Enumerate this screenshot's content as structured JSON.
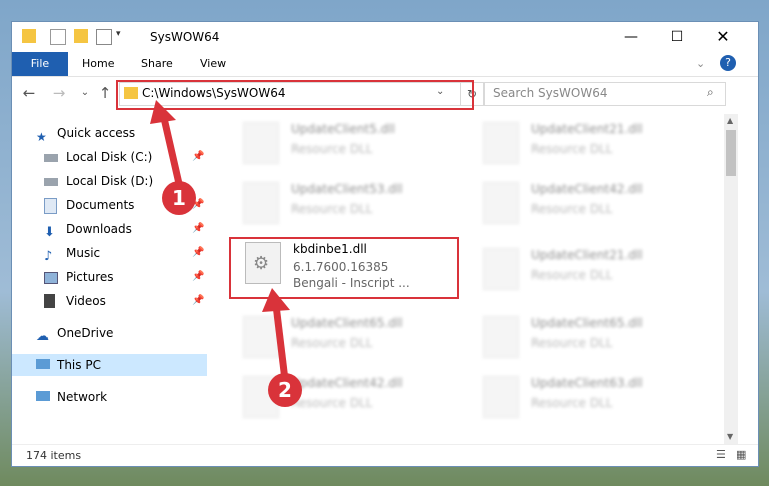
{
  "window": {
    "title": "SysWOW64"
  },
  "ribbon": {
    "tabs": [
      "File",
      "Home",
      "Share",
      "View"
    ]
  },
  "address": {
    "path": "C:\\Windows\\SysWOW64",
    "search_placeholder": "Search SysWOW64"
  },
  "sidebar": {
    "items": [
      {
        "label": "Quick access",
        "pinned": false
      },
      {
        "label": "Local Disk (C:)",
        "pinned": true
      },
      {
        "label": "Local Disk (D:)",
        "pinned": false
      },
      {
        "label": "Documents",
        "pinned": true
      },
      {
        "label": "Downloads",
        "pinned": true
      },
      {
        "label": "Music",
        "pinned": true
      },
      {
        "label": "Pictures",
        "pinned": true
      },
      {
        "label": "Videos",
        "pinned": true
      },
      {
        "label": "OneDrive",
        "pinned": false
      },
      {
        "label": "This PC",
        "pinned": false,
        "selected": true
      },
      {
        "label": "Network",
        "pinned": false
      }
    ]
  },
  "files": {
    "left": [
      {
        "name": "UpdateClient5.dll",
        "sub": "Resource DLL"
      },
      {
        "name": "UpdateClient53.dll",
        "sub": "Resource DLL"
      },
      {
        "name": "kbdinbe1.dll",
        "sub": "6.1.7600.16385",
        "sub2": "Bengali - Inscript ..."
      },
      {
        "name": "UpdateClient65.dll",
        "sub": "Resource DLL"
      },
      {
        "name": "UpdateClient42.dll",
        "sub": "Resource DLL"
      }
    ],
    "right": [
      {
        "name": "UpdateClient21.dll",
        "sub": "Resource DLL"
      },
      {
        "name": "UpdateClient42.dll",
        "sub": "Resource DLL"
      },
      {
        "name": "UpdateClient21.dll",
        "sub": "Resource DLL"
      },
      {
        "name": "UpdateClient65.dll",
        "sub": "Resource DLL"
      },
      {
        "name": "UpdateClient63.dll",
        "sub": "Resource DLL"
      }
    ]
  },
  "status": {
    "count": "174 items"
  },
  "annotations": {
    "step1": "1",
    "step2": "2"
  },
  "colors": {
    "accent": "#1f5fb0",
    "highlight": "#d9333a",
    "selected": "#cce8ff"
  }
}
